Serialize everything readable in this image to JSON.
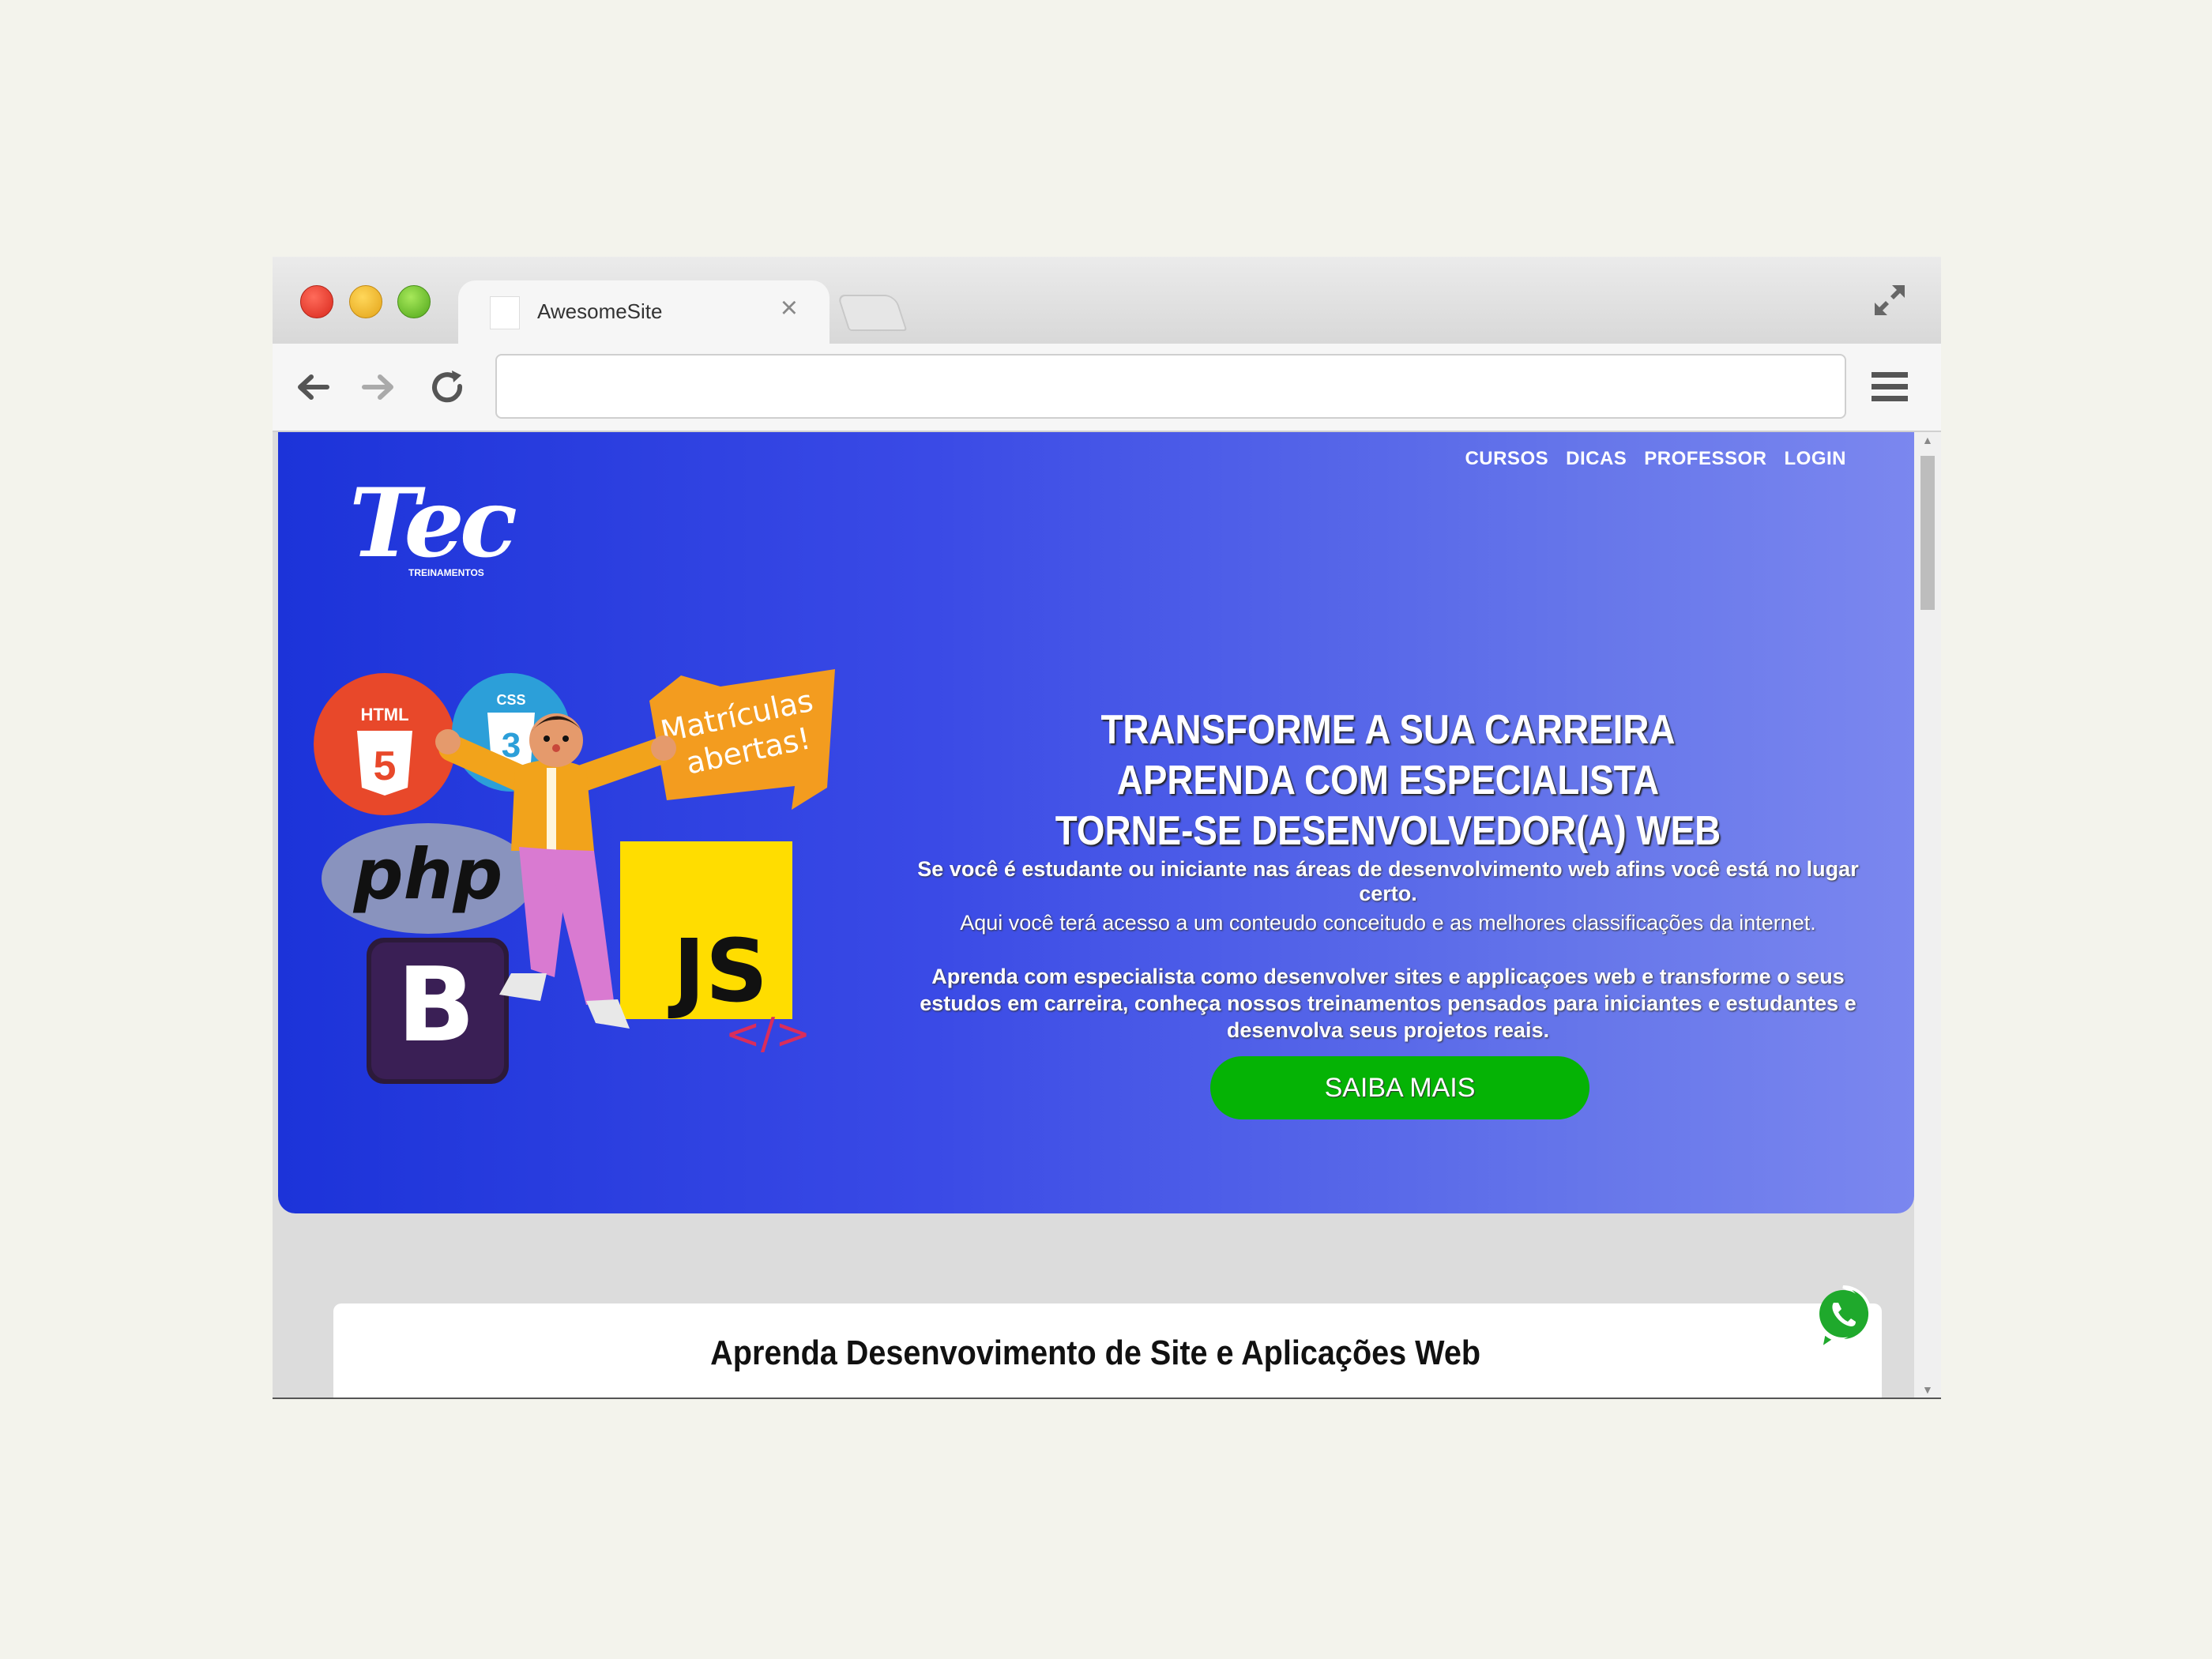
{
  "browser": {
    "tab_title": "AwesomeSite",
    "url": ""
  },
  "nav": {
    "items": [
      "CURSOS",
      "DICAS",
      "PROFESSOR",
      "LOGIN"
    ]
  },
  "logo": {
    "text": "Tec",
    "subtext": "TREINAMENTOS"
  },
  "art": {
    "html_badge": "HTML",
    "html_number": "5",
    "css_badge": "CSS",
    "css_number": "3",
    "php": "php",
    "bootstrap": "B",
    "js": "JS",
    "code_tag": "</>",
    "banner_line1": "Matrículas",
    "banner_line2": "abertas!"
  },
  "hero": {
    "headline": [
      "TRANSFORME A SUA CARREIRA",
      "APRENDA COM ESPECIALISTA",
      "TORNE-SE DESENVOLVEDOR(A) WEB"
    ],
    "paragraph1": "Se você é estudante ou iniciante nas áreas de desenvolvimento web afins você está no lugar certo.",
    "paragraph2": "Aqui você terá acesso a um conteudo conceitudo e as melhores classificações da internet.",
    "paragraph3": "Aprenda com especialista como desenvolver sites e applicaçoes web e transforme o seus estudos em carreira, conheça nossos treinamentos pensados para iniciantes e estudantes e desenvolva seus projetos reais.",
    "cta_label": "SAIBA MAIS"
  },
  "section": {
    "title": "Aprenda Desenvovimento de Site e Aplicações Web"
  },
  "colors": {
    "hero_start": "#1c33d9",
    "hero_end": "#7b87ef",
    "cta": "#05b305",
    "whatsapp": "#1fa92c"
  },
  "icons": [
    "back-arrow-icon",
    "forward-arrow-icon",
    "reload-icon",
    "hamburger-menu-icon",
    "expand-icon",
    "close-icon",
    "whatsapp-icon"
  ]
}
